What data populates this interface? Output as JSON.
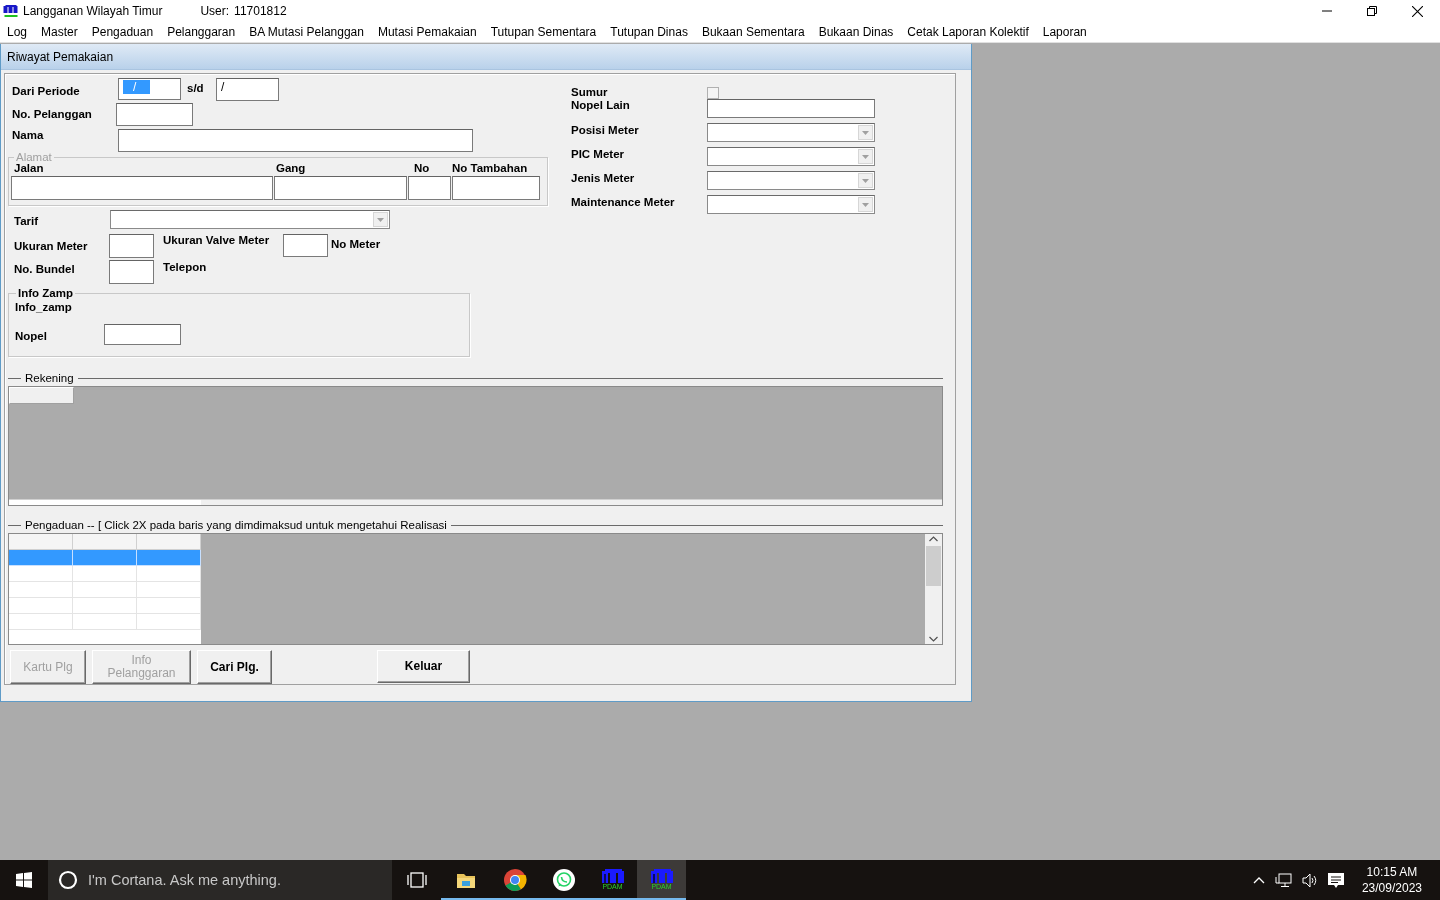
{
  "app": {
    "title": "Langganan Wilayah Timur",
    "user_label": "User:",
    "user": "11701812"
  },
  "menu": [
    "Log",
    "Master",
    "Pengaduan",
    "Pelanggaran",
    "BA Mutasi Pelanggan",
    "Mutasi Pemakaian",
    "Tutupan Sementara",
    "Tutupan Dinas",
    "Bukaan Sementara",
    "Bukaan Dinas",
    "Cetak Laporan Kolektif",
    "Laporan"
  ],
  "window": {
    "title": "Riwayat Pemakaian"
  },
  "form": {
    "periode": {
      "label": "Dari Periode",
      "from": "/",
      "from_selected": true,
      "separator": "s/d",
      "to": "/"
    },
    "no_pelanggan": "No. Pelanggan",
    "nama": "Nama",
    "alamat": {
      "legend": "Alamat",
      "columns": [
        "Jalan",
        "Gang",
        "No",
        "No Tambahan"
      ]
    },
    "tarif": "Tarif",
    "ukuran_meter": "Ukuran Meter",
    "ukuran_valve_meter": "Ukuran Valve Meter",
    "no_meter": "No Meter",
    "no_bundel": "No. Bundel",
    "telepon": "Telepon",
    "info_zamp": {
      "legend": "Info Zamp",
      "label": "Info_zamp",
      "nopel": "Nopel"
    },
    "right": [
      {
        "kind": "checkbox",
        "label": "Sumur",
        "checked": false
      },
      {
        "kind": "text",
        "label": "Nopel Lain"
      },
      {
        "kind": "combo",
        "label": "Posisi Meter"
      },
      {
        "kind": "combo",
        "label": "PIC Meter"
      },
      {
        "kind": "combo",
        "label": "Jenis Meter"
      },
      {
        "kind": "combo",
        "label": "Maintenance Meter"
      }
    ]
  },
  "rekening": {
    "legend": "Rekening"
  },
  "pengaduan": {
    "legend": "Pengaduan -- [ Click 2X pada baris yang dimdimaksud untuk mengetahui Realisasi",
    "rows": [
      {
        "selected": true
      },
      {
        "selected": false
      },
      {
        "selected": false
      },
      {
        "selected": false
      },
      {
        "selected": false
      }
    ]
  },
  "buttons": [
    {
      "label": "Kartu Plg",
      "disabled": true
    },
    {
      "label": "Info Pelanggaran",
      "disabled": true
    },
    {
      "label": "Cari Plg.",
      "disabled": false
    },
    {
      "label": "Keluar",
      "disabled": false
    }
  ],
  "taskbar": {
    "search_placeholder": "I'm Cortana. Ask me anything.",
    "apps": [
      {
        "kind": "task-view",
        "running": false,
        "selected": false
      },
      {
        "kind": "folder",
        "running": true,
        "selected": false
      },
      {
        "kind": "chrome",
        "running": true,
        "selected": false
      },
      {
        "kind": "whatsapp",
        "running": true,
        "selected": false
      },
      {
        "kind": "pdam",
        "label": "PDAM",
        "running": true,
        "selected": false
      },
      {
        "kind": "pdam",
        "label": "PDAM",
        "running": true,
        "selected": true
      }
    ],
    "time": "10:15 AM",
    "date": "23/09/2023"
  }
}
